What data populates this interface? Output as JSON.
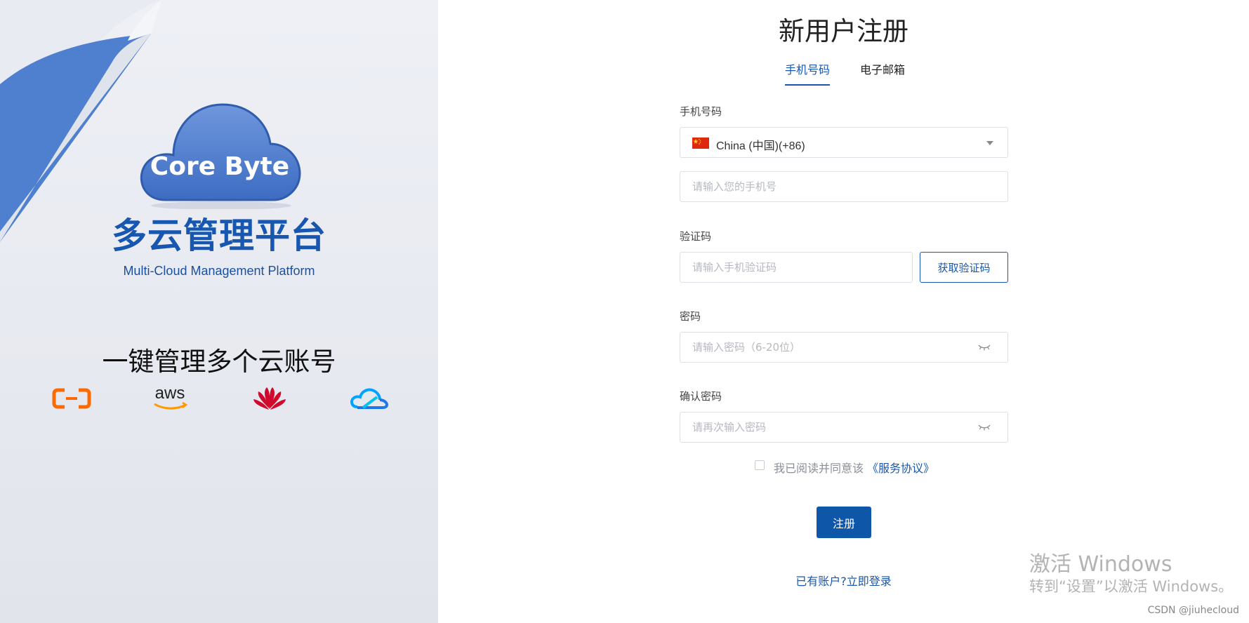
{
  "brand": {
    "logo_text": "Core Byte",
    "title": "多云管理平台",
    "subtitle": "Multi-Cloud Management Platform",
    "slogan": "一键管理多个云账号",
    "providers": [
      "aliyun-icon",
      "aws-icon",
      "huawei-icon",
      "tencent-cloud-icon"
    ],
    "aws_text": "aws",
    "colors": {
      "primary": "#1757b0",
      "logo_blue": "#4f7fcf",
      "aliyun": "#ff6a00",
      "huawei": "#cf0a2c",
      "tencent": "#1ba0f2"
    }
  },
  "form": {
    "title": "新用户注册",
    "tabs": [
      {
        "label": "手机号码",
        "active": true
      },
      {
        "label": "电子邮箱",
        "active": false
      }
    ],
    "phone_label": "手机号码",
    "country_value": "China (中国)(+86)",
    "phone_placeholder": "请输入您的手机号",
    "code_label": "验证码",
    "code_placeholder": "请输入手机验证码",
    "get_code_button": "获取验证码",
    "password_label": "密码",
    "password_placeholder": "请输入密码（6-20位）",
    "confirm_label": "确认密码",
    "confirm_placeholder": "请再次输入密码",
    "agree_text": "我已阅读并同意该",
    "agree_link": "《服务协议》",
    "agree_checked": false,
    "register_button": "注册",
    "login_link": "已有账户?立即登录"
  },
  "watermark": {
    "title": "激活 Windows",
    "subtitle": "转到“设置”以激活 Windows。"
  },
  "credit": "CSDN @jiuhecloud"
}
